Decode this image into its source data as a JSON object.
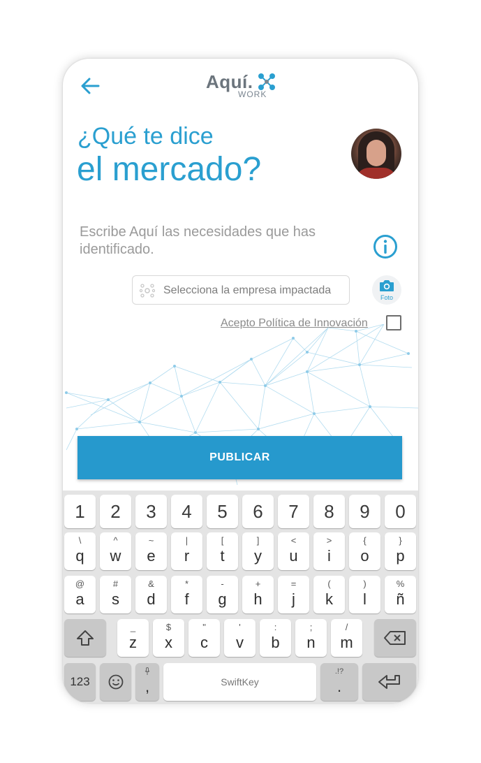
{
  "header": {
    "logo_word": "Aquí.",
    "logo_sub": "WORK"
  },
  "title": {
    "line1": "¿Qué te dice",
    "line2": "el mercado?"
  },
  "form": {
    "subtitle": "Escribe Aquí las necesidades que has identificado.",
    "company_placeholder": "Selecciona la empresa impactada",
    "photo_label": "Foto",
    "policy_label": "Acepto Política de Innovación",
    "policy_checked": false,
    "publish_label": "PUBLICAR"
  },
  "colors": {
    "accent": "#2a9fd0",
    "button": "#2699cd"
  },
  "keyboard": {
    "numbers": [
      "1",
      "2",
      "3",
      "4",
      "5",
      "6",
      "7",
      "8",
      "9",
      "0"
    ],
    "row1": [
      {
        "main": "q",
        "sec": "\\"
      },
      {
        "main": "w",
        "sec": "^"
      },
      {
        "main": "e",
        "sec": "~"
      },
      {
        "main": "r",
        "sec": "|"
      },
      {
        "main": "t",
        "sec": "["
      },
      {
        "main": "y",
        "sec": "]"
      },
      {
        "main": "u",
        "sec": "<"
      },
      {
        "main": "i",
        "sec": ">"
      },
      {
        "main": "o",
        "sec": "{"
      },
      {
        "main": "p",
        "sec": "}"
      }
    ],
    "row2": [
      {
        "main": "a",
        "sec": "@"
      },
      {
        "main": "s",
        "sec": "#"
      },
      {
        "main": "d",
        "sec": "&"
      },
      {
        "main": "f",
        "sec": "*"
      },
      {
        "main": "g",
        "sec": "-"
      },
      {
        "main": "h",
        "sec": "+"
      },
      {
        "main": "j",
        "sec": "="
      },
      {
        "main": "k",
        "sec": "("
      },
      {
        "main": "l",
        "sec": ")"
      },
      {
        "main": "ñ",
        "sec": "%"
      }
    ],
    "row3": [
      {
        "main": "z",
        "sec": "_"
      },
      {
        "main": "x",
        "sec": "$"
      },
      {
        "main": "c",
        "sec": "\""
      },
      {
        "main": "v",
        "sec": "'"
      },
      {
        "main": "b",
        "sec": ":"
      },
      {
        "main": "n",
        "sec": ";"
      },
      {
        "main": "m",
        "sec": "/"
      }
    ],
    "sym_label": "123",
    "comma": ",",
    "period": ".",
    "space_label": "SwiftKey"
  }
}
